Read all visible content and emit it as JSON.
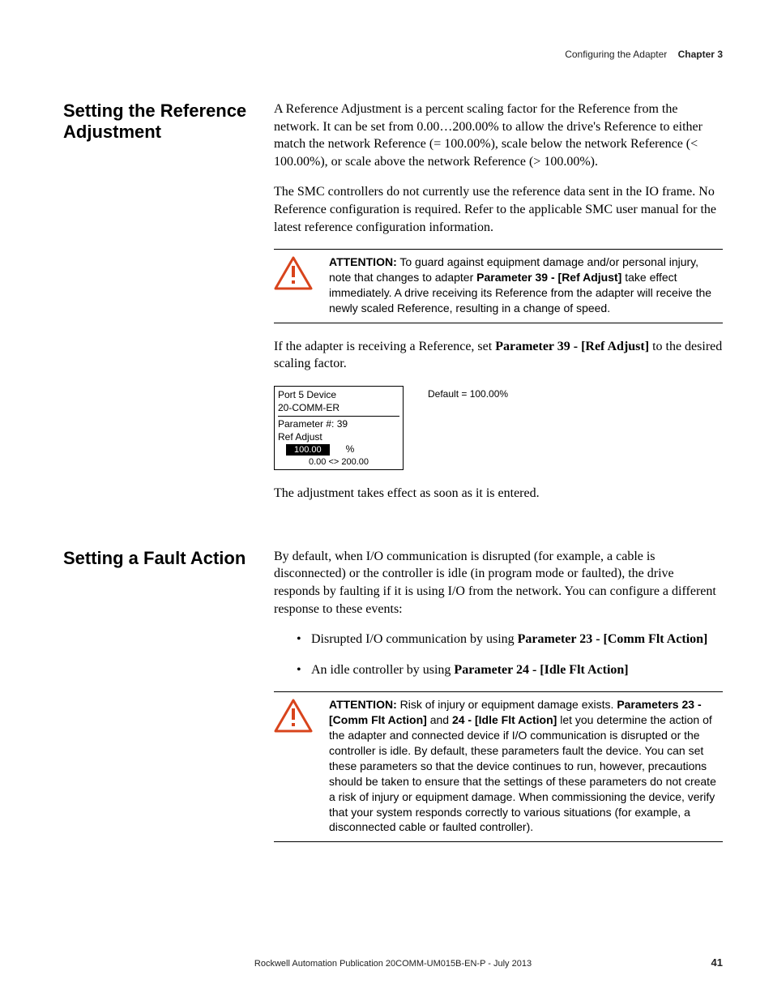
{
  "header": {
    "left": "Configuring the Adapter",
    "right": "Chapter 3"
  },
  "section1": {
    "heading": "Setting the Reference Adjustment",
    "p1": "A Reference Adjustment is a percent scaling factor for the Reference from the network. It can be set from 0.00…200.00% to allow the drive's Reference to either match the network Reference (= 100.00%), scale below the network Reference (< 100.00%), or scale above the network Reference (> 100.00%).",
    "p2": "The SMC controllers do not currently use the reference data sent in the IO frame. No Reference configuration is required. Refer to the applicable SMC user manual for the latest reference configuration information.",
    "attention_label": "ATTENTION:",
    "attention_pre": " To guard against equipment damage and/or personal injury, note that changes to adapter ",
    "attention_bold": "Parameter 39 - [Ref Adjust]",
    "attention_post": " take effect immediately. A drive receiving its Reference from the adapter will receive the newly scaled Reference, resulting in a change of speed.",
    "p3_pre": "If the adapter is receiving a Reference, set ",
    "p3_bold": "Parameter 39 - [Ref Adjust]",
    "p3_post": " to the desired scaling factor.",
    "panel": {
      "line1": "Port 5 Device",
      "line2": "20-COMM-ER",
      "line3": "Parameter #: 39",
      "line4": "Ref Adjust",
      "value": "100.00",
      "unit": "%",
      "range": "0.00 <> 200.00"
    },
    "default_label": "Default = 100.00%",
    "p4": "The adjustment takes effect as soon as it is entered."
  },
  "section2": {
    "heading": "Setting a Fault Action",
    "p1": "By default, when I/O communication is disrupted (for example, a cable is disconnected) or the controller is idle (in program mode or faulted), the drive responds by faulting if it is using I/O from the network. You can configure a different response to these events:",
    "bullet1_pre": "Disrupted I/O communication by using ",
    "bullet1_bold": "Parameter 23 - [Comm Flt Action]",
    "bullet2_pre": "An idle controller by using ",
    "bullet2_bold": "Parameter 24 - [Idle Flt Action]",
    "attention_label": "ATTENTION:",
    "attention_pre": " Risk of injury or equipment damage exists. ",
    "attention_b1": "Parameters 23 - [Comm Flt Action]",
    "attention_mid1": " and ",
    "attention_b2": "24 - [Idle Flt Action]",
    "attention_post": " let you determine the action of the adapter and connected device if I/O communication is disrupted or the controller is idle. By default, these parameters fault the device. You can set these parameters so that the device continues to run, however, precautions should be taken to ensure that the settings of these parameters do not create a risk of injury or equipment damage. When commissioning the device, verify that your system responds correctly to various situations (for example, a disconnected cable or faulted controller)."
  },
  "footer": {
    "pub": "Rockwell Automation Publication  20COMM-UM015B-EN-P - July 2013",
    "page": "41"
  }
}
